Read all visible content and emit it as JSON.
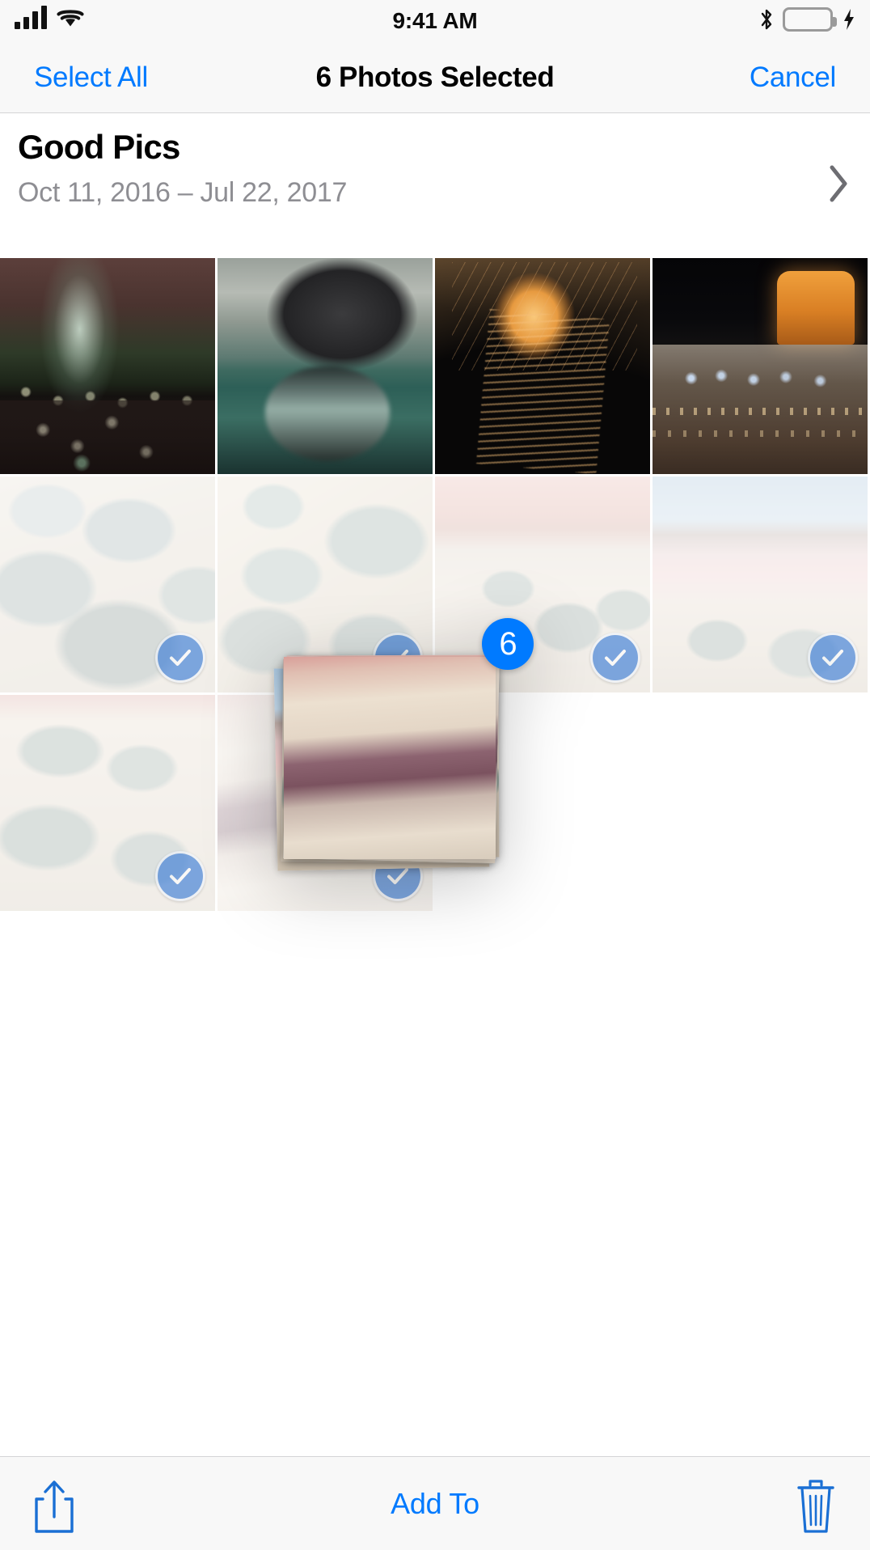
{
  "status_bar": {
    "time": "9:41 AM",
    "signal_icon": "cellular-signal-icon",
    "signal_bars_filled": 4,
    "wifi_icon": "wifi-icon",
    "bluetooth_icon": "bluetooth-icon",
    "battery_icon": "battery-icon",
    "battery_color": "#4cd55c",
    "charging_icon": "lightning-bolt-icon"
  },
  "nav_bar": {
    "select_all_label": "Select All",
    "title": "6 Photos Selected",
    "cancel_label": "Cancel",
    "tint_color": "#007aff"
  },
  "album_header": {
    "title": "Good Pics",
    "date_range": "Oct 11, 2016 – Jul 22, 2017",
    "disclosure_icon": "chevron-right-icon"
  },
  "grid": {
    "columns": 4,
    "photos": [
      {
        "id": 1,
        "description": "Lighthouse at night with reflections",
        "art": "art-lighthouse",
        "selected": false,
        "ghosted": false
      },
      {
        "id": 2,
        "description": "Penguin half above half below water",
        "art": "art-penguin",
        "selected": false,
        "ghosted": false
      },
      {
        "id": 3,
        "description": "Orange jellyfish on black water",
        "art": "art-jelly",
        "selected": false,
        "ghosted": false
      },
      {
        "id": 4,
        "description": "Ocean liner lit up at night",
        "art": "art-ship",
        "selected": false,
        "ghosted": false
      },
      {
        "id": 5,
        "description": "Salt flat mineral pools",
        "art": "art-salt1",
        "selected": true,
        "ghosted": true
      },
      {
        "id": 6,
        "description": "Salt flat mineral pools close up",
        "art": "art-salt2",
        "selected": true,
        "ghosted": true
      },
      {
        "id": 7,
        "description": "Pink salt lake shoreline",
        "art": "art-salt3",
        "selected": true,
        "ghosted": true
      },
      {
        "id": 8,
        "description": "Pink lagoon with distant hills",
        "art": "art-salt4",
        "selected": true,
        "ghosted": true
      },
      {
        "id": 9,
        "description": "Dry salt crust with grey pools",
        "art": "art-salt5",
        "selected": true,
        "ghosted": true
      },
      {
        "id": 10,
        "description": "Purple brine stream across salt flat",
        "art": "art-salt6",
        "selected": true,
        "ghosted": true
      }
    ],
    "selection_check_icon": "checkmark-circle-icon",
    "selection_color": "#3478d6"
  },
  "drag": {
    "badge_count": "6",
    "badge_color": "#007aff",
    "stack_cards": [
      {
        "art": "art-salt4"
      },
      {
        "art": "art-salt5"
      },
      {
        "art": "art-salt3"
      },
      {
        "art": "art-salt6"
      },
      {
        "art": "art-salt7"
      }
    ]
  },
  "toolbar": {
    "share_icon": "share-up-arrow-icon",
    "add_to_label": "Add To",
    "trash_icon": "trash-can-icon",
    "tint_color": "#007aff"
  }
}
